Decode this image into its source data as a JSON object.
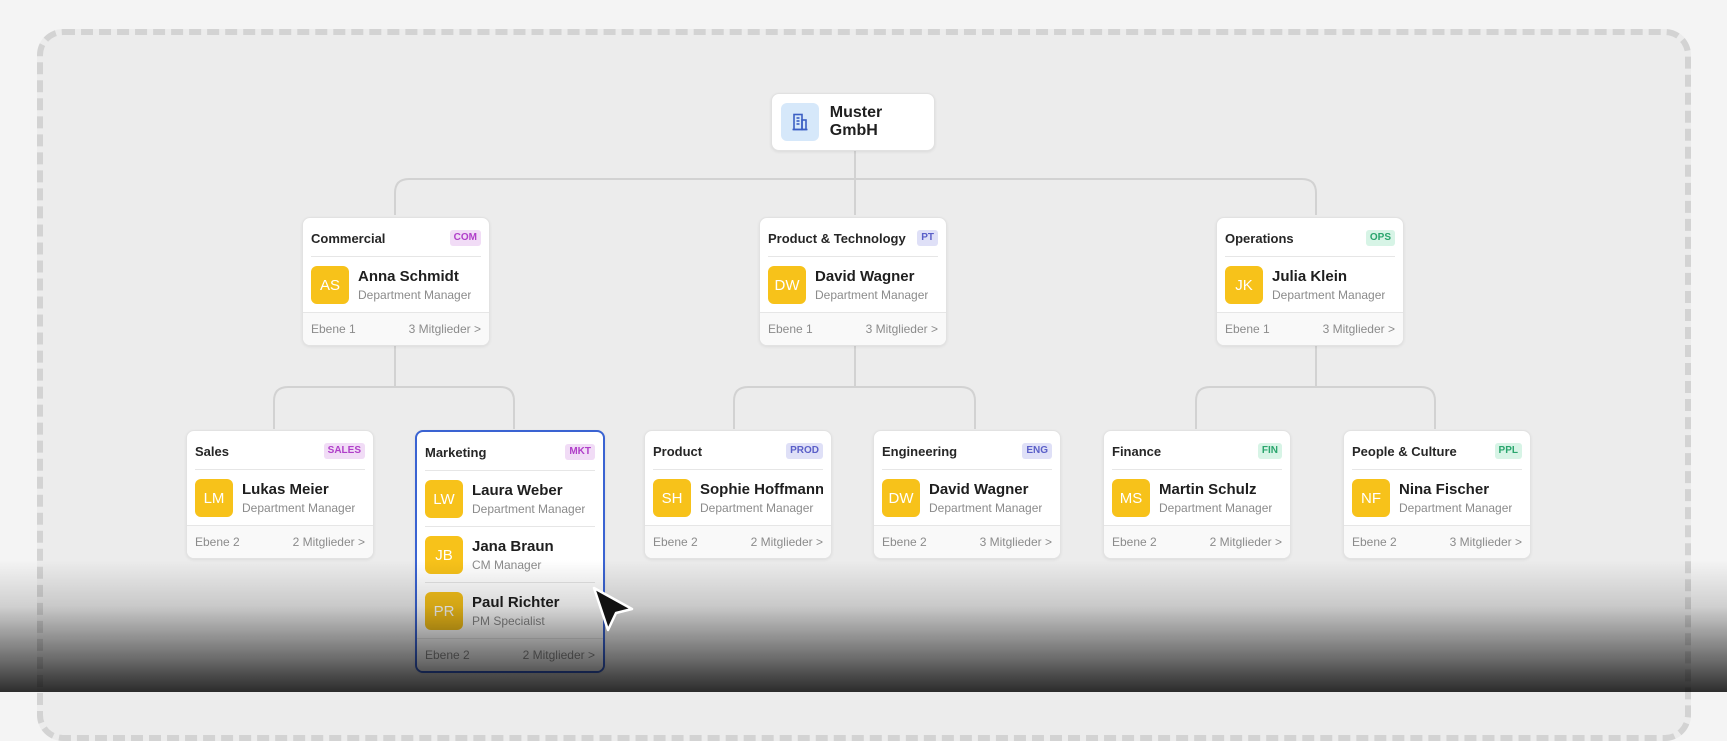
{
  "root": {
    "name": "Muster GmbH",
    "icon": "building-icon"
  },
  "departments": [
    {
      "id": "commercial",
      "name": "Commercial",
      "tag": "COM",
      "tag_bg": "#f1dcf6",
      "tag_fg": "#b03ec9",
      "members": [
        {
          "initials": "AS",
          "name": "Anna Schmidt",
          "role": "Department Manager"
        }
      ],
      "level": "Ebene 1",
      "count": "3 Mitglieder >"
    },
    {
      "id": "product-technology",
      "name": "Product & Technology",
      "tag": "PT",
      "tag_bg": "#dfe0f7",
      "tag_fg": "#5a5fc8",
      "members": [
        {
          "initials": "DW",
          "name": "David Wagner",
          "role": "Department Manager"
        }
      ],
      "level": "Ebene 1",
      "count": "3 Mitglieder >"
    },
    {
      "id": "operations",
      "name": "Operations",
      "tag": "OPS",
      "tag_bg": "#d7f4e6",
      "tag_fg": "#2aa56d",
      "members": [
        {
          "initials": "JK",
          "name": "Julia Klein",
          "role": "Department Manager"
        }
      ],
      "level": "Ebene 1",
      "count": "3 Mitglieder >"
    },
    {
      "id": "sales",
      "name": "Sales",
      "tag": "SALES",
      "tag_bg": "#f1dcf6",
      "tag_fg": "#b03ec9",
      "members": [
        {
          "initials": "LM",
          "name": "Lukas Meier",
          "role": "Department Manager"
        }
      ],
      "level": "Ebene 2",
      "count": "2 Mitglieder >"
    },
    {
      "id": "marketing",
      "name": "Marketing",
      "tag": "MKT",
      "tag_bg": "#f1dcf6",
      "tag_fg": "#b03ec9",
      "members": [
        {
          "initials": "LW",
          "name": "Laura Weber",
          "role": "Department Manager"
        },
        {
          "initials": "JB",
          "name": "Jana Braun",
          "role": "CM Manager"
        },
        {
          "initials": "PR",
          "name": "Paul Richter",
          "role": "PM Specialist"
        }
      ],
      "level": "Ebene 2",
      "count": "2 Mitglieder >"
    },
    {
      "id": "product",
      "name": "Product",
      "tag": "PROD",
      "tag_bg": "#dfe0f7",
      "tag_fg": "#5a5fc8",
      "members": [
        {
          "initials": "SH",
          "name": "Sophie Hoffmann",
          "role": "Department Manager"
        }
      ],
      "level": "Ebene 2",
      "count": "2 Mitglieder >"
    },
    {
      "id": "engineering",
      "name": "Engineering",
      "tag": "ENG",
      "tag_bg": "#dfe0f7",
      "tag_fg": "#5a5fc8",
      "members": [
        {
          "initials": "DW",
          "name": "David Wagner",
          "role": "Department Manager"
        }
      ],
      "level": "Ebene 2",
      "count": "3 Mitglieder >"
    },
    {
      "id": "finance",
      "name": "Finance",
      "tag": "FIN",
      "tag_bg": "#d7f4e6",
      "tag_fg": "#2aa56d",
      "members": [
        {
          "initials": "MS",
          "name": "Martin Schulz",
          "role": "Department Manager"
        }
      ],
      "level": "Ebene 2",
      "count": "2 Mitglieder >"
    },
    {
      "id": "people-culture",
      "name": "People & Culture",
      "tag": "PPL",
      "tag_bg": "#d7f4e6",
      "tag_fg": "#2aa56d",
      "members": [
        {
          "initials": "NF",
          "name": "Nina Fischer",
          "role": "Department Manager"
        }
      ],
      "level": "Ebene 2",
      "count": "3 Mitglieder >"
    }
  ],
  "colors": {
    "avatar": "#f7c21a",
    "selected_border": "#3a63d2",
    "connector": "#d2d2d2"
  }
}
